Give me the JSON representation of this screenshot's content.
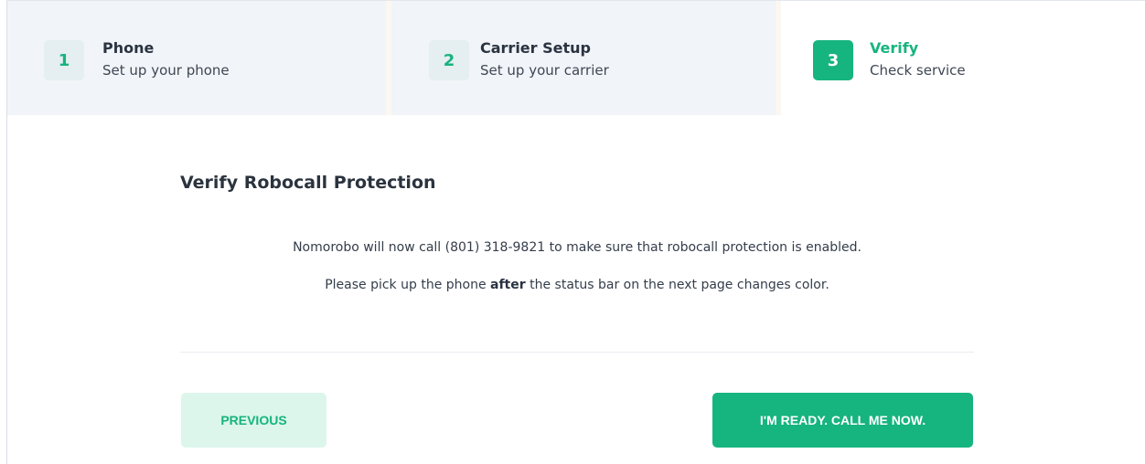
{
  "steps": [
    {
      "number": "1",
      "title": "Phone",
      "subtitle": "Set up your phone",
      "state": "inactive"
    },
    {
      "number": "2",
      "title": "Carrier Setup",
      "subtitle": "Set up your carrier",
      "state": "inactive"
    },
    {
      "number": "3",
      "title": "Verify",
      "subtitle": "Check service",
      "state": "active"
    }
  ],
  "content": {
    "heading": "Verify Robocall Protection",
    "paragraph1": "Nomorobo will now call (801) 318-9821 to make sure that robocall protection is enabled.",
    "paragraph2_before": "Please pick up the phone ",
    "paragraph2_bold": "after",
    "paragraph2_after": " the status bar on the next page changes color."
  },
  "buttons": {
    "previous_label": "PREVIOUS",
    "ready_label": "I'M READY. CALL ME NOW."
  },
  "colors": {
    "accent": "#16b47e",
    "step_bg": "#f1f4f8",
    "secondary_button_bg": "#dcf6ec"
  }
}
